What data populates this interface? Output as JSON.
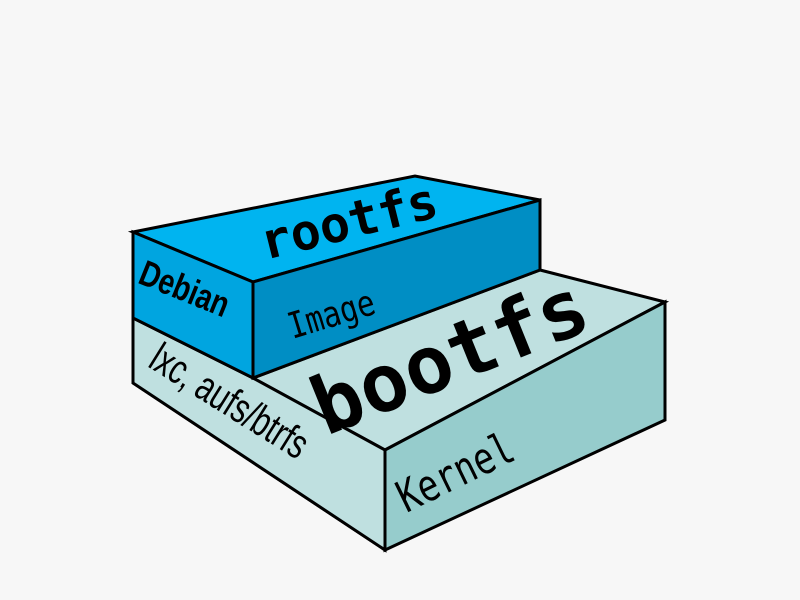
{
  "diagram": {
    "layers": [
      {
        "id": "rootfs",
        "top_label": "rootfs",
        "front_label": "Debian",
        "side_label": "Image",
        "colors": {
          "top": "#00b4f0",
          "front": "#00a5e0",
          "side": "#008ec4"
        }
      },
      {
        "id": "bootfs",
        "top_label": "bootfs",
        "front_label": "lxc, aufs/btrfs",
        "side_label": "Kernel",
        "colors": {
          "top": "#bfe0e0",
          "front": "#bfe0e0",
          "side": "#96cccc"
        }
      }
    ]
  }
}
